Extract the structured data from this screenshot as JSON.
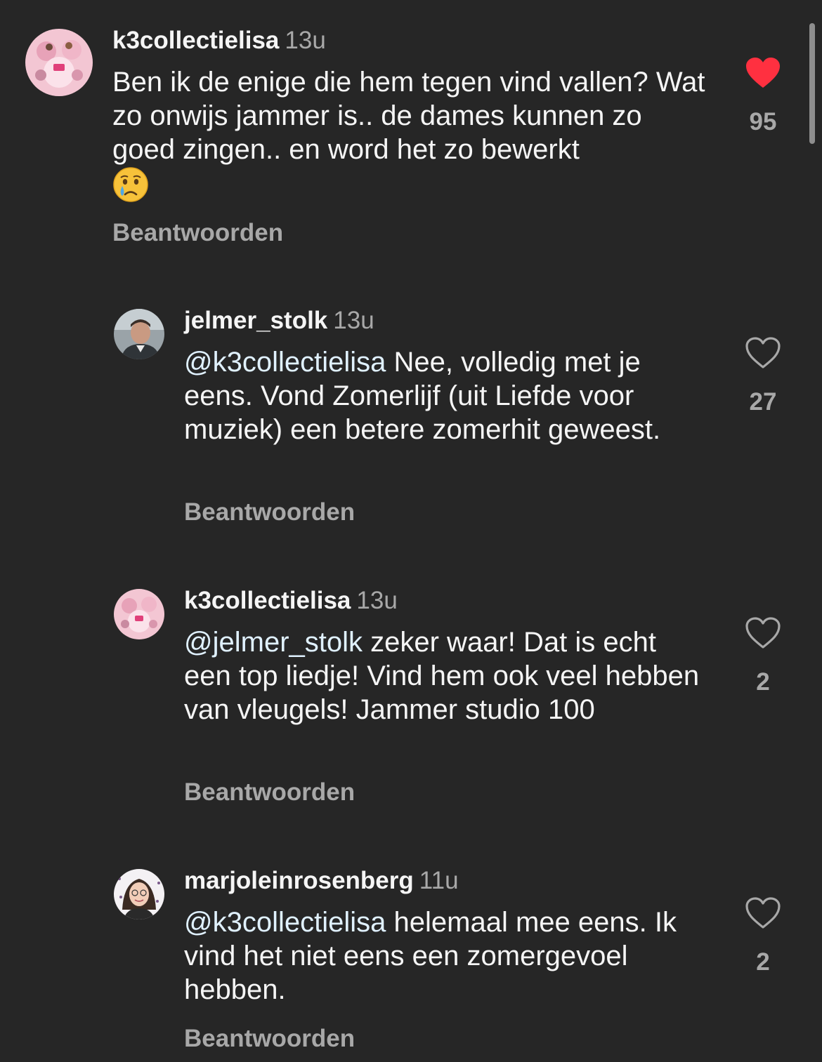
{
  "comments": [
    {
      "username": "k3collectielisa",
      "time": "13u",
      "mention": "",
      "text": "Ben ik de enige die hem tegen vind vallen? Wat zo onwijs jammer is.. de dames kunnen zo goed zingen.. en word het zo bewerkt",
      "emoji": "crying-face-emoji",
      "reply_label": "Beantwoorden",
      "like_count": "95",
      "liked": true,
      "avatar": "k3-collage-avatar"
    },
    {
      "username": "jelmer_stolk",
      "time": "13u",
      "mention": "@k3collectielisa",
      "text": " Nee, volledig met je eens. Vond Zomerlijf (uit Liefde voor muziek) een betere zomerhit geweest.",
      "reply_label": "Beantwoorden",
      "like_count": "27",
      "liked": false,
      "avatar": "man-photo-avatar"
    },
    {
      "username": "k3collectielisa",
      "time": "13u",
      "mention": "@jelmer_stolk",
      "text": " zeker waar! Dat is echt een top liedje! Vind hem ook veel hebben van vleugels! Jammer studio 100",
      "reply_label": "Beantwoorden",
      "like_count": "2",
      "liked": false,
      "avatar": "k3-collage-avatar"
    },
    {
      "username": "marjoleinrosenberg",
      "time": "11u",
      "mention": "@k3collectielisa",
      "text": " helemaal mee eens. Ik vind het niet eens een zomergevoel hebben.",
      "reply_label": "Beantwoorden",
      "like_count": "2",
      "liked": false,
      "avatar": "woman-photo-avatar"
    }
  ],
  "colors": {
    "background": "#262626",
    "text": "#f5f5f5",
    "secondary": "#a8a8a8",
    "mention": "#e0f1ff",
    "like_active": "#ff3040"
  }
}
